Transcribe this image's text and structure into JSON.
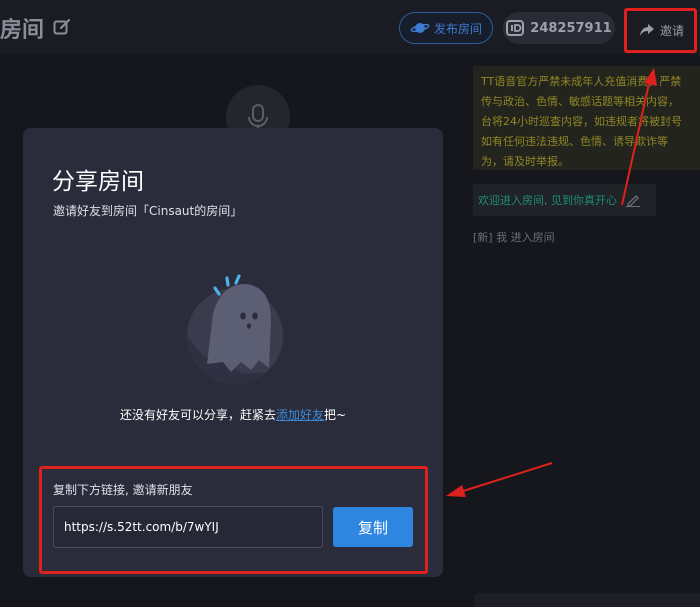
{
  "header": {
    "room_title": "房间",
    "publish_label": "发布房间",
    "room_id": "248257911",
    "invite_label": "邀请"
  },
  "room": {
    "notice_text": "TT语音官方严禁未成年人充值消费，严禁\n传与政治、色情、敏感话题等相关内容，\n台将24小时巡查内容，如违规者将被封号\n如有任何违法违规、色情、诱导欺诈等\n为，请及时举报。",
    "welcome_text": "欢迎进入房间, 见到你真开心",
    "system_message": "[新] 我 进入房间"
  },
  "share_modal": {
    "title": "分享房间",
    "subtitle": "邀请好友到房间「Cinsaut的房间」",
    "empty_prefix": "还没有好友可以分享，赶紧去",
    "empty_link": "添加好友",
    "empty_suffix": "把~",
    "copy_hint": "复制下方链接, 邀请新朋友",
    "share_link": "https://s.52tt.com/b/7wYIJ",
    "copy_label": "复制"
  },
  "colors": {
    "accent": "#2f86e0",
    "highlight": "#e0201c",
    "modal_bg": "#2a2c3b",
    "notice_text": "#8f8824"
  },
  "icons": [
    "edit-icon",
    "planet-icon",
    "id-icon",
    "share-arrow-icon",
    "mic-icon",
    "ghost-icon",
    "pencil-icon"
  ]
}
